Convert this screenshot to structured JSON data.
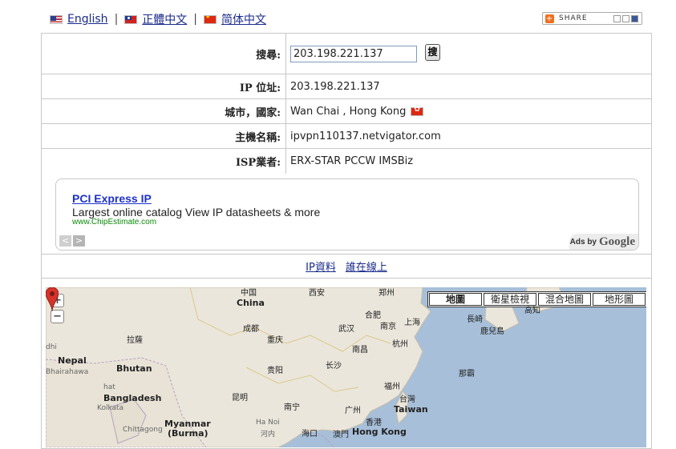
{
  "lang_bar": {
    "english": "English",
    "traditional": "正體中文",
    "simplified": "简体中文",
    "separator": "|"
  },
  "share": {
    "label": "SHARE"
  },
  "form": {
    "search_label": "搜尋:",
    "search_value": "203.198.221.137",
    "search_button": "搜",
    "ip_label": "IP 位址:",
    "ip_value": "203.198.221.137",
    "city_label": "城市，國家:",
    "city_value": "Wan Chai , Hong Kong",
    "host_label": "主機名稱:",
    "host_value": "ipvpn110137.netvigator.com",
    "isp_label": "ISP業者:",
    "isp_value": "ERX-STAR PCCW IMSBiz"
  },
  "ad": {
    "title": "PCI Express IP",
    "text": "Largest online catalog View IP datasheets & more",
    "url": "www.ChipEstimate.com",
    "ads_by": "Ads by",
    "google": "Google",
    "prev": "<",
    "next": ">"
  },
  "links": {
    "ip_data": "IP資料",
    "who_online": "誰在線上"
  },
  "map": {
    "zoom_in": "+",
    "zoom_out": "−",
    "types": [
      "地圖",
      "衛星檢視",
      "混合地圖",
      "地形圖"
    ],
    "active_type": "地圖",
    "colors": {
      "land": "#ebe6dc",
      "water": "#a7bfd9",
      "border": "#b6a0c2",
      "marker": "#d6332b"
    },
    "labels": {
      "zhongguo": "中国",
      "china": "China",
      "xian": "西安",
      "zhengzhou": "郑州",
      "hefei": "合肥",
      "nanjing": "南京",
      "shanghai": "上海",
      "changqi": "長崎",
      "kochi": "高知",
      "kagoshima": "鹿兒島",
      "lhasa": "拉薩",
      "chengdu": "成都",
      "chongqing": "重庆",
      "wuhan": "武汉",
      "hangzhou": "杭州",
      "nanchang": "南昌",
      "dhi": "dhi",
      "nepal": "Nepal",
      "bhutan": "Bhutan",
      "bhairahawa": "Bhairahawa",
      "guiyang": "贵阳",
      "changsha": "长沙",
      "naba": "那霸",
      "hat": "hat",
      "bangladesh": "Bangladesh",
      "kolkata": "Kolkata",
      "chittagong": "Chittagong",
      "kunming": "昆明",
      "nanning": "南宁",
      "fuzhou": "福州",
      "taiwan_cn": "台灣",
      "taiwan": "Taiwan",
      "guangzhou": "广州",
      "xianggang": "香港",
      "hongkong": "Hong Kong",
      "haikou": "海口",
      "aomen": "澳門",
      "myanmar": "Myanmar",
      "burma": "(Burma)",
      "hanoi": "Ha Noi",
      "hanoi_cn": "河内"
    }
  }
}
